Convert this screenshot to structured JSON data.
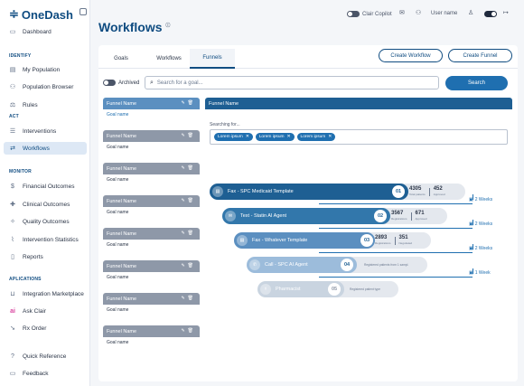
{
  "app": {
    "name": "OneDash"
  },
  "sidebar": {
    "dashboard": "Dashboard",
    "sections": {
      "identify": "IDENTIFY",
      "act": "ACT",
      "monitor": "MONITOR",
      "aplications": "APLICATIONS"
    },
    "items": {
      "my_population": "My Population",
      "population_browser": "Population Browser",
      "rules": "Rules",
      "interventions": "Interventions",
      "workflows": "Workflows",
      "financial_outcomes": "Financial Outcomes",
      "clinical_outcomes": "Clinical Outcomes",
      "quality_outcomes": "Quality Outcomes",
      "intervention_statistics": "Intervention Statistics",
      "reports": "Reports",
      "integration_marketplace": "Integration Marketplace",
      "ask_clair": "Ask Clair",
      "rx_order": "Rx Order",
      "quick_reference": "Quick Reference",
      "feedback": "Feedback"
    }
  },
  "topbar": {
    "clair_copilot": "Clair Copilot",
    "user_name": "User name"
  },
  "page": {
    "title": "Workflows",
    "info": "ⓘ"
  },
  "tabs": [
    "Goals",
    "Workflows",
    "Funnels"
  ],
  "actions": {
    "create_workflow": "Create Workflow",
    "create_funnel": "Create Funnel"
  },
  "filters": {
    "archived": "Archived",
    "search_placeholder": "Search for a goal...",
    "search_button": "Search"
  },
  "funnels": [
    {
      "name": "Funnel Name",
      "goal": "Goal name"
    },
    {
      "name": "Funnel Name",
      "goal": "Goal name"
    },
    {
      "name": "Funnel Name",
      "goal": "Goal name"
    },
    {
      "name": "Funnel Name",
      "goal": "Goal name"
    },
    {
      "name": "Funnel Name",
      "goal": "Goal name"
    },
    {
      "name": "Funnel Name",
      "goal": "Goal name"
    },
    {
      "name": "Funnel Name",
      "goal": "Goal name"
    },
    {
      "name": "Funnel Name",
      "goal": "Goal name"
    }
  ],
  "detail": {
    "title": "Funnel Name",
    "searching": "Searching for...",
    "chips": [
      "Lorem ipsum",
      "Lorem ipsum",
      "Lorem ipsum"
    ],
    "stages": [
      {
        "label": "Fax - SPC Medicaid Template",
        "num": "01",
        "v1": "4305",
        "l1": "Total patients",
        "v2": "452",
        "l2": "Approved",
        "weeks": "2 Weeks"
      },
      {
        "label": "Text - Statin AI Agent",
        "num": "02",
        "v1": "3567",
        "l1": "Registrations",
        "v2": "671",
        "l2": "Approved",
        "weeks": "2 Weeks"
      },
      {
        "label": "Fax - Whatever Template",
        "num": "03",
        "v1": "2893",
        "l1": "Registrations",
        "v2": "351",
        "l2": "Negotiated",
        "weeks": "2 Weeks"
      },
      {
        "label": "Call - SPC AI Agent",
        "num": "04",
        "note": "Registered patients from 1 sampl.",
        "weeks": "1 Week"
      },
      {
        "label": "Pharmacist",
        "num": "05",
        "note": "Registered patient type"
      }
    ]
  }
}
